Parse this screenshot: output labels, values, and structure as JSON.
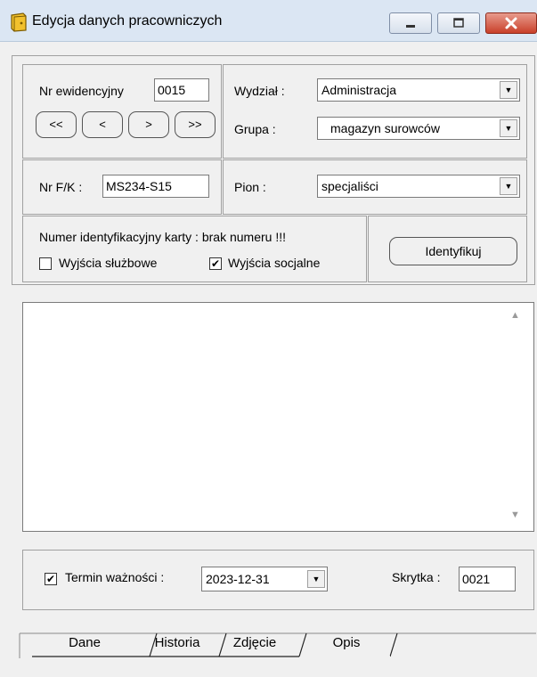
{
  "window": {
    "title": "Edycja danych pracowniczych"
  },
  "record": {
    "nr_label": "Nr ewidencyjny",
    "nr_value": "0015",
    "nav": [
      "<<",
      "<",
      ">",
      ">>"
    ],
    "wydzial_label": "Wydział :",
    "wydzial_value": "Administracja",
    "grupa_label": "Grupa :",
    "grupa_value": "magazyn surowców",
    "nrfk_label": "Nr F/K :",
    "nrfk_value": "MS234-S15",
    "pion_label": "Pion :",
    "pion_value": "specjaliści"
  },
  "card": {
    "label": "Numer identyfikacyjny karty : brak numeru !!!",
    "wyjscia_sluzbowe_label": "Wyjścia służbowe",
    "wyjscia_sluzbowe_checked": false,
    "wyjscia_socjalne_label": "Wyjścia socjalne",
    "wyjscia_socjalne_checked": true,
    "identify_button": "Identyfikuj"
  },
  "footer": {
    "termin_checked": true,
    "termin_label": "Termin ważności :",
    "termin_value": "2023-12-31",
    "skrytka_label": "Skrytka :",
    "skrytka_value": "0021"
  },
  "tabs": [
    "Dane",
    "Historia",
    "Zdjęcie",
    "Opis"
  ],
  "active_tab": "Opis",
  "icons": {
    "app": "door-key-icon",
    "minimize": "minimize-icon",
    "maximize": "maximize-icon",
    "close": "close-icon"
  }
}
